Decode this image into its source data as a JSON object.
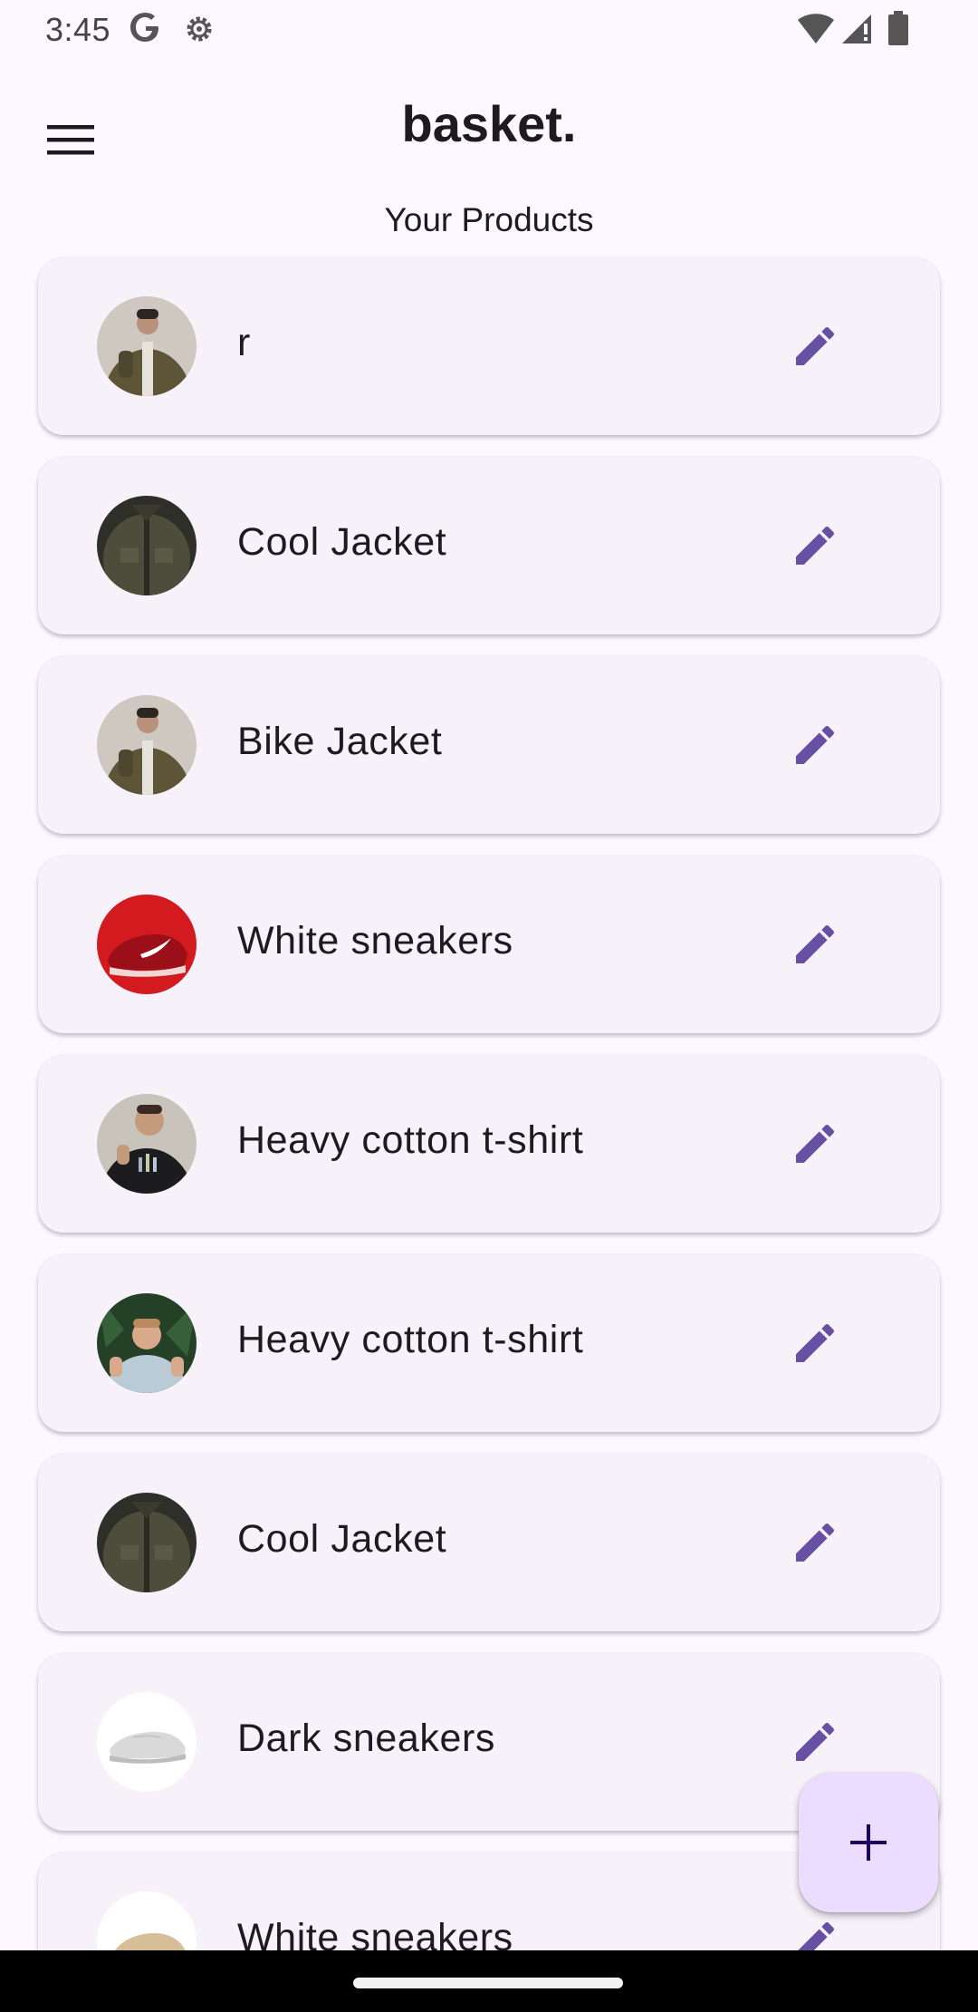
{
  "status_bar": {
    "time": "3:45",
    "icons": [
      "google-g-icon",
      "settings-gear-icon",
      "wifi-icon",
      "cell-signal-icon",
      "battery-icon"
    ]
  },
  "app_bar": {
    "title": "basket.",
    "menu_icon": "hamburger-menu-icon"
  },
  "section_title": "Your Products",
  "products": [
    {
      "name": "r",
      "thumbnail": "olive-jacket-model",
      "edit_icon": "pencil-icon"
    },
    {
      "name": "Cool Jacket",
      "thumbnail": "dark-green-jacket",
      "edit_icon": "pencil-icon"
    },
    {
      "name": "Bike Jacket",
      "thumbnail": "olive-jacket-model",
      "edit_icon": "pencil-icon"
    },
    {
      "name": "White sneakers",
      "thumbnail": "red-sneaker",
      "edit_icon": "pencil-icon"
    },
    {
      "name": "Heavy cotton t-shirt",
      "thumbnail": "man-black-tshirt",
      "edit_icon": "pencil-icon"
    },
    {
      "name": "Heavy cotton t-shirt",
      "thumbnail": "woman-light-tshirt",
      "edit_icon": "pencil-icon"
    },
    {
      "name": "Cool Jacket",
      "thumbnail": "dark-green-jacket",
      "edit_icon": "pencil-icon"
    },
    {
      "name": "Dark sneakers",
      "thumbnail": "white-sneaker",
      "edit_icon": "pencil-icon"
    },
    {
      "name": "White sneakers",
      "thumbnail": "tan-sneaker",
      "edit_icon": "pencil-icon"
    }
  ],
  "fab": {
    "icon": "plus-icon"
  },
  "colors": {
    "background": "#fdf7ff",
    "card": "#f7f1f9",
    "accent": "#6750a4",
    "fab": "#eaddff",
    "fab_icon": "#21005d"
  }
}
